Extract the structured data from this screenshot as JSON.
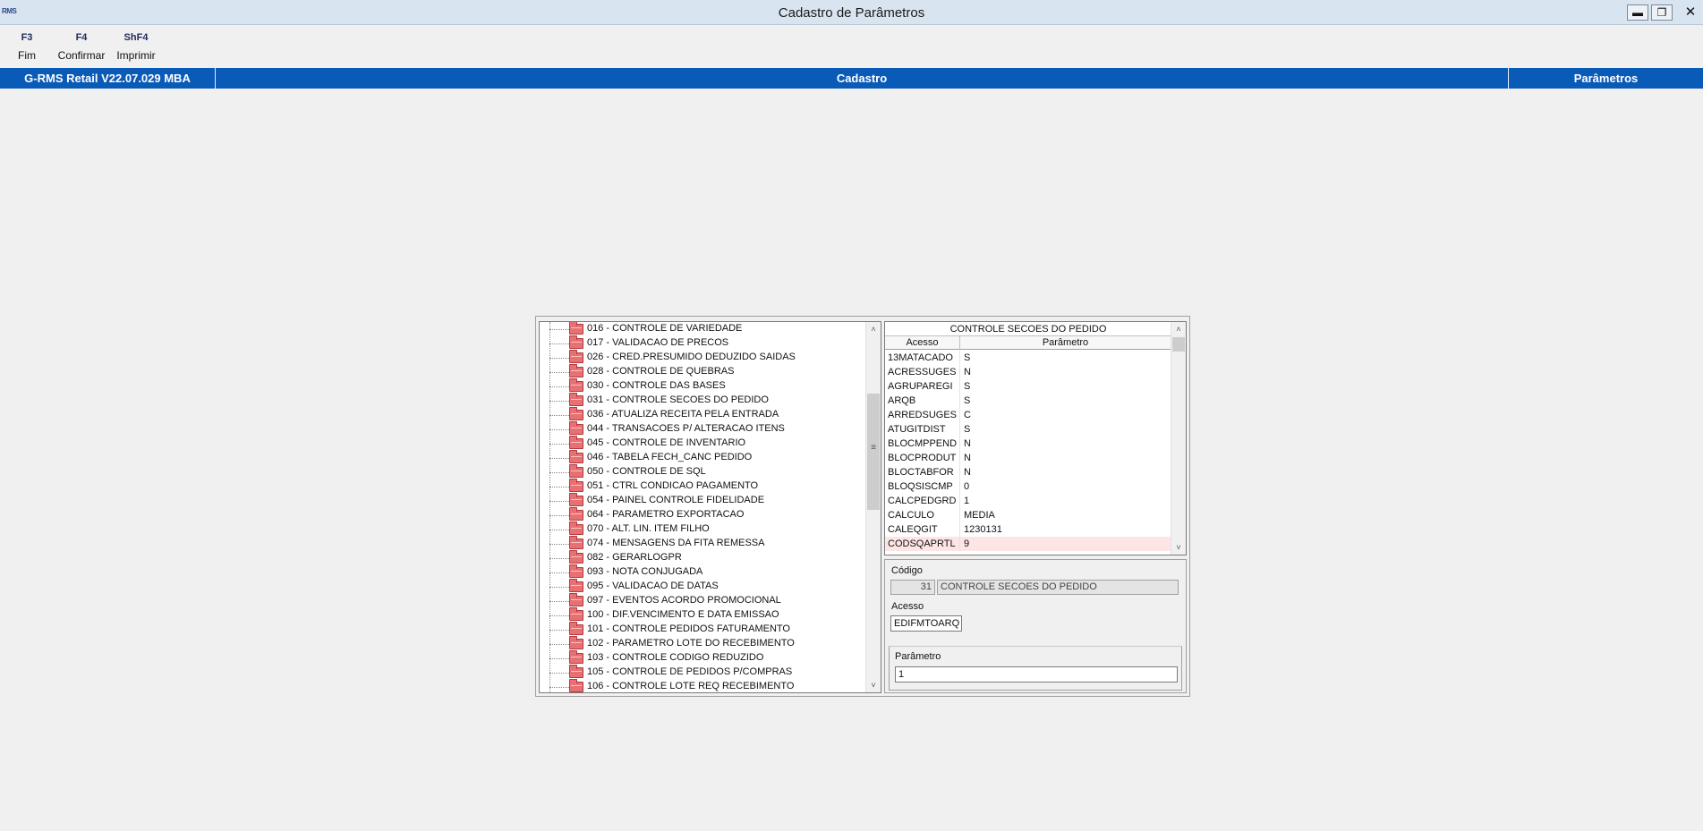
{
  "window": {
    "logo_text": "RMS",
    "title": "Cadastro de Parâmetros",
    "minimize": "▬",
    "restore": "❐",
    "close": "✕"
  },
  "function_keys": [
    {
      "code": "F3",
      "label": "Fim"
    },
    {
      "code": "F4",
      "label": "Confirmar"
    },
    {
      "code": "ShF4",
      "label": "Imprimir"
    }
  ],
  "infobar": {
    "version": "G-RMS Retail V22.07.029 MBA",
    "module": "Cadastro",
    "screen": "Parâmetros"
  },
  "tree": {
    "items": [
      "016 - CONTROLE DE VARIEDADE",
      "017 - VALIDACAO DE PRECOS",
      "026 - CRED.PRESUMIDO DEDUZIDO SAIDAS",
      "028 - CONTROLE DE QUEBRAS",
      "030 - CONTROLE DAS BASES",
      "031 - CONTROLE SECOES DO PEDIDO",
      "036 - ATUALIZA RECEITA PELA ENTRADA",
      "044 - TRANSACOES P/ ALTERACAO ITENS",
      "045 - CONTROLE DE INVENTARIO",
      "046 - TABELA FECH_CANC PEDIDO",
      "050 - CONTROLE DE SQL",
      "051 - CTRL CONDICAO PAGAMENTO",
      "054 - PAINEL CONTROLE FIDELIDADE",
      "064 - PARAMETRO EXPORTACAO",
      "070 - ALT. LIN. ITEM FILHO",
      "074 - MENSAGENS DA FITA REMESSA",
      "082 - GERARLOGPR",
      "093 - NOTA CONJUGADA",
      "095 - VALIDACAO DE DATAS",
      "097 - EVENTOS ACORDO PROMOCIONAL",
      "100 - DIF.VENCIMENTO E DATA EMISSAO",
      "101 - CONTROLE PEDIDOS FATURAMENTO",
      "102 - PARAMETRO LOTE DO RECEBIMENTO",
      "103 - CONTROLE CODIGO REDUZIDO",
      "105 - CONTROLE DE PEDIDOS P/COMPRAS",
      "106 - CONTROLE LOTE REQ RECEBIMENTO"
    ],
    "scroll_up": "˄",
    "scroll_down": "˅",
    "grip": "≡"
  },
  "grid": {
    "title": "CONTROLE SECOES DO PEDIDO",
    "col_acesso": "Acesso",
    "col_parametro": "Parâmetro",
    "rows": [
      {
        "acesso": "13MATACADO",
        "parametro": "S"
      },
      {
        "acesso": "ACRESSUGES",
        "parametro": "N"
      },
      {
        "acesso": "AGRUPAREGI",
        "parametro": "S"
      },
      {
        "acesso": "ARQB",
        "parametro": "S"
      },
      {
        "acesso": "ARREDSUGES",
        "parametro": "C"
      },
      {
        "acesso": "ATUGITDIST",
        "parametro": "S"
      },
      {
        "acesso": "BLOCMPPEND",
        "parametro": "N"
      },
      {
        "acesso": "BLOCPRODUT",
        "parametro": "N"
      },
      {
        "acesso": "BLOCTABFOR",
        "parametro": "N"
      },
      {
        "acesso": "BLOQSISCMP",
        "parametro": "0"
      },
      {
        "acesso": "CALCPEDGRD",
        "parametro": "1"
      },
      {
        "acesso": "CALCULO",
        "parametro": "MEDIA"
      },
      {
        "acesso": "CALEQGIT",
        "parametro": "1230131"
      },
      {
        "acesso": "CODSQAPRTL",
        "parametro": "9"
      }
    ],
    "scroll_up": "˄",
    "scroll_down": "˅"
  },
  "form": {
    "codigo_label": "Código",
    "codigo_value": "31",
    "codigo_desc": "CONTROLE SECOES DO PEDIDO",
    "acesso_label": "Acesso",
    "acesso_value": "EDIFMTOARQ",
    "parametro_label": "Parâmetro",
    "parametro_value": "1"
  }
}
